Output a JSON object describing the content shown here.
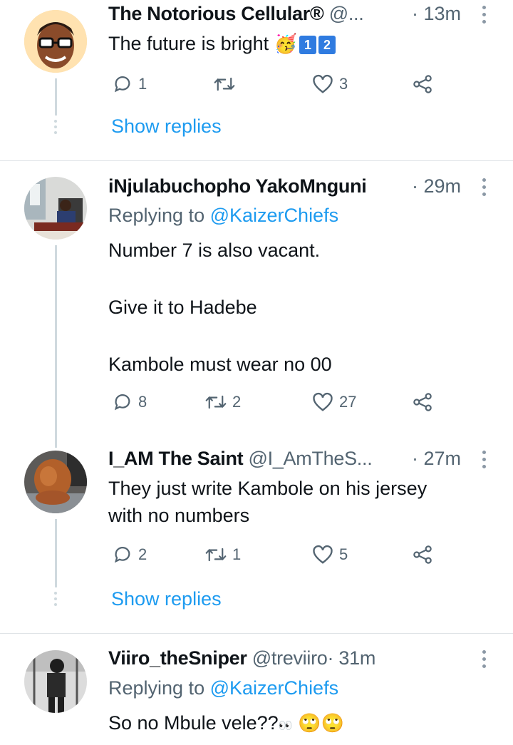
{
  "tweets": [
    {
      "name": "The Notorious Cellular®",
      "handle": "@...",
      "time": "· 13m",
      "lines": [
        "The future is bright"
      ],
      "emoji": [
        "🥳",
        "1",
        "2"
      ],
      "replies": "1",
      "retweets": "",
      "likes": "3",
      "show_replies": "Show replies"
    },
    {
      "name": "iNjulabuchopho YakoMnguni",
      "handle": "",
      "time": "· 29m",
      "replying_prefix": "Replying to",
      "replying_to": "@KaizerChiefs",
      "lines": [
        "Number 7 is also vacant.",
        "Give it to Hadebe",
        "Kambole must wear no 00"
      ],
      "replies": "8",
      "retweets": "2",
      "likes": "27"
    },
    {
      "name": "I_AM The Saint",
      "handle": "@I_AmTheS...",
      "time": "· 27m",
      "lines": [
        "They just write Kambole on his jersey",
        "with no numbers"
      ],
      "replies": "2",
      "retweets": "1",
      "likes": "5",
      "show_replies": "Show replies"
    },
    {
      "name": "Viiro_theSniper",
      "handle": "@treviiro",
      "time": "· 31m",
      "replying_prefix": "Replying to",
      "replying_to": "@KaizerChiefs",
      "lines": [
        "So no Mbule vele??"
      ],
      "emoji": [
        "👀",
        "🙄",
        "🙄"
      ]
    }
  ],
  "colors": {
    "link": "#1d9bf0",
    "muted": "#536471",
    "thread": "#cfd9de"
  },
  "icons": [
    "reply-icon",
    "retweet-icon",
    "like-icon",
    "share-icon",
    "more-icon"
  ]
}
